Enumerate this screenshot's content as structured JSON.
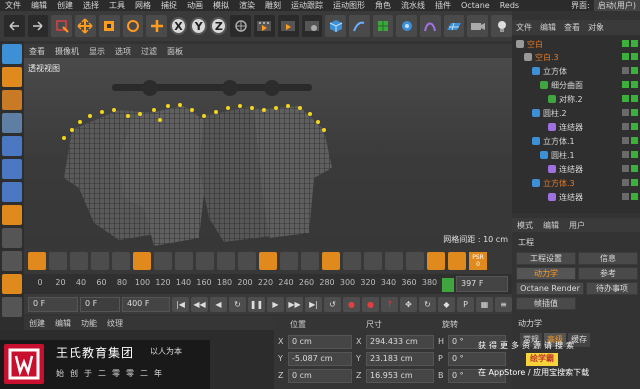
{
  "menubar": {
    "items": [
      "文件",
      "编辑",
      "创建",
      "选择",
      "工具",
      "网格",
      "捕捉",
      "动画",
      "模拟",
      "渲染",
      "雕刻",
      "运动跟踪",
      "运动图形",
      "角色",
      "流水线",
      "插件",
      "Octane",
      "Reds"
    ],
    "layout_label": "界面:",
    "layout_value": "启动(用户)"
  },
  "toolbar": {
    "axis_x": "X",
    "axis_y": "Y",
    "axis_z": "Z"
  },
  "viewport": {
    "menu": [
      "查看",
      "摄像机",
      "显示",
      "选项",
      "过滤",
      "面板"
    ],
    "view_label": "透视视图",
    "grid_readout": "网格间距 : 10 cm"
  },
  "timeline": {
    "psr_label": "PSR",
    "psr_value": "0",
    "ticks": [
      "0",
      "20",
      "40",
      "60",
      "80",
      "100",
      "120",
      "140",
      "160",
      "180",
      "200",
      "220",
      "240",
      "260",
      "280",
      "300",
      "320",
      "340",
      "360",
      "380"
    ],
    "end_field": "397 F",
    "start_frame": "0 F",
    "current_frame": "0 F",
    "end_frame": "400 F",
    "max_frame": "400 F"
  },
  "materials": {
    "menu": [
      "创建",
      "编辑",
      "功能",
      "纹理"
    ]
  },
  "coords": {
    "pos_header": "位置",
    "size_header": "尺寸",
    "rot_header": "旋转",
    "rows": [
      {
        "axis": "X",
        "pos": "0 cm",
        "size_axis": "X",
        "size": "294.433 cm",
        "rot_axis": "H",
        "rot": "0 °"
      },
      {
        "axis": "Y",
        "pos": "-5.087 cm",
        "size_axis": "Y",
        "size": "23.183 cm",
        "rot_axis": "P",
        "rot": "0 °"
      },
      {
        "axis": "Z",
        "pos": "0 cm",
        "size_axis": "Z",
        "size": "16.953 cm",
        "rot_axis": "B",
        "rot": "0 °"
      }
    ]
  },
  "objects": {
    "menu": [
      "文件",
      "编辑",
      "查看",
      "对象"
    ],
    "items": [
      {
        "label": "空白",
        "color": "#e07a2a"
      },
      {
        "label": "空白.3",
        "color": "#e07a2a"
      },
      {
        "label": "立方体",
        "color": "#d8d8d8"
      },
      {
        "label": "细分曲面",
        "color": "#d8d8d8"
      },
      {
        "label": "对称.2",
        "color": "#d8d8d8"
      },
      {
        "label": "圆柱.2",
        "color": "#d8d8d8"
      },
      {
        "label": "连结器",
        "color": "#d8d8d8"
      },
      {
        "label": "立方体.1",
        "color": "#d8d8d8"
      },
      {
        "label": "圆柱.1",
        "color": "#d8d8d8"
      },
      {
        "label": "连结器",
        "color": "#d8d8d8"
      },
      {
        "label": "立方体.3",
        "color": "#e07a2a"
      },
      {
        "label": "连结器",
        "color": "#d8d8d8"
      }
    ]
  },
  "attributes": {
    "tabs": [
      "模式",
      "编辑",
      "用户"
    ],
    "title": "工程",
    "buttons": [
      "工程设置",
      "信息",
      "动力学",
      "参考",
      "Octane Render",
      "待办事项",
      "帧插值"
    ],
    "active_button": "动力学",
    "section": "动力学",
    "subtabs": [
      "常规",
      "高级",
      "缓存"
    ]
  },
  "overlay": {
    "brand_name": "王氏教育集团",
    "brand_slogan": "以人为本",
    "brand_tagline": "始创于二零零二年",
    "store_top": "获得更多资源请搜索",
    "store_badge": "绘学霸",
    "store_bottom": "在 AppStore / 应用宝搜索下载"
  }
}
